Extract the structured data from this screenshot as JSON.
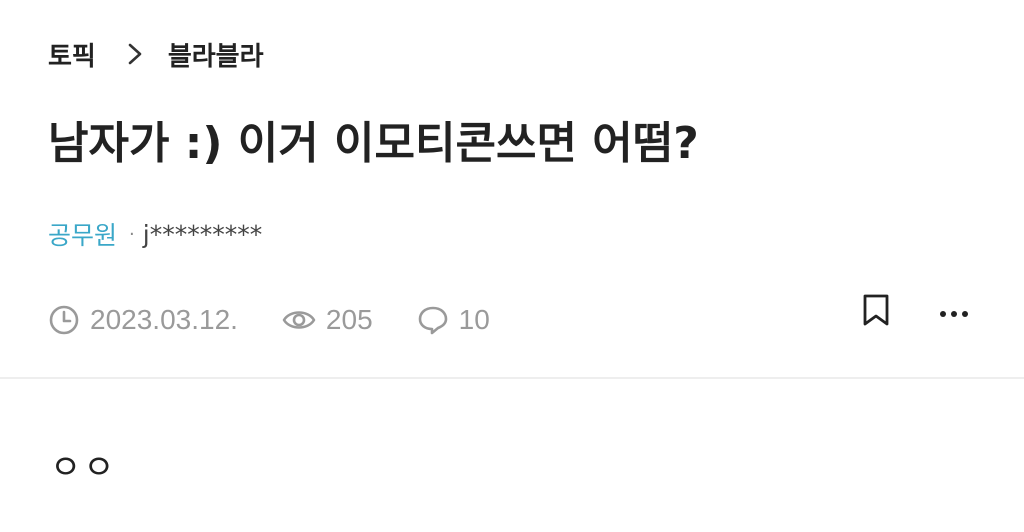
{
  "breadcrumb": {
    "category": "토픽",
    "separator_icon": "chevron-right-icon",
    "topic": "블라블라"
  },
  "post": {
    "title": "남자가 :) 이거 이모티콘쓰면 어떰?",
    "author_job": "공무원",
    "author_separator": "·",
    "author_nickname": "j*********",
    "date": "2023.03.12.",
    "views": "205",
    "comments": "10",
    "body": "ㅇㅇ"
  },
  "icons": {
    "date": "clock-icon",
    "views": "eye-icon",
    "comments": "comment-icon",
    "bookmark": "bookmark-icon",
    "more": "more-horizontal-icon"
  },
  "colors": {
    "author_job": "#3aa7c8",
    "meta_text": "#9a9a9a",
    "title": "#222222"
  }
}
